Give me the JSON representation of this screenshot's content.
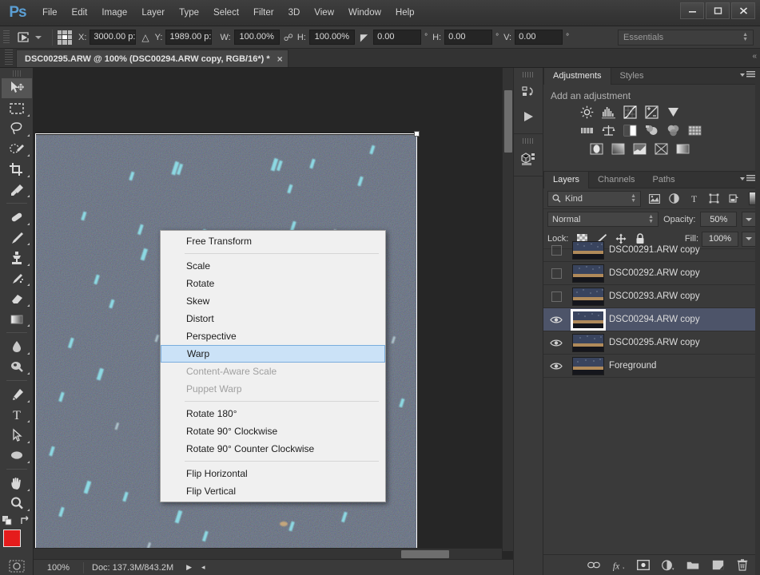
{
  "app": {
    "name": "Adobe Photoshop",
    "logo": "Ps"
  },
  "menubar": {
    "items": [
      "File",
      "Edit",
      "Image",
      "Layer",
      "Type",
      "Select",
      "Filter",
      "3D",
      "View",
      "Window",
      "Help"
    ]
  },
  "window_controls": {
    "minimize": "minimize-icon",
    "maximize": "maximize-icon",
    "close": "close-icon"
  },
  "options_bar": {
    "tool_icon": "move-tool-icon",
    "preset_caret": "chevron-down-icon",
    "reference_point_label": "reference-point-grid",
    "x_label": "X:",
    "x_value": "3000.00 p:",
    "delta_icon": "triangle-icon",
    "y_label": "Y:",
    "y_value": "1989.00 p:",
    "w_label": "W:",
    "w_value": "100.00%",
    "link_icon": "chain-link-icon",
    "h_label": "H:",
    "h_value": "100.00%",
    "angle_icon": "angle-icon",
    "angle_value": "0.00",
    "angle_unit": "°",
    "hskew_label": "H:",
    "hskew_value": "0.00",
    "hskew_unit": "°",
    "vskew_label": "V:",
    "vskew_value": "0.00",
    "vskew_unit": "°",
    "workspace": "Essentials"
  },
  "document_tab": {
    "title": "DSC00295.ARW @ 100% (DSC00294.ARW copy, RGB/16*) *",
    "close": "×"
  },
  "toolbar": {
    "tools": [
      {
        "name": "move-tool",
        "selected": true
      },
      {
        "name": "rectangular-marquee-tool",
        "selected": false
      },
      {
        "name": "lasso-tool",
        "selected": false
      },
      {
        "name": "quick-selection-tool",
        "selected": false
      },
      {
        "name": "crop-tool",
        "selected": false
      },
      {
        "name": "eyedropper-tool",
        "selected": false
      },
      {
        "name": "healing-brush-tool",
        "selected": false
      },
      {
        "name": "brush-tool",
        "selected": false
      },
      {
        "name": "clone-stamp-tool",
        "selected": false
      },
      {
        "name": "history-brush-tool",
        "selected": false
      },
      {
        "name": "eraser-tool",
        "selected": false
      },
      {
        "name": "gradient-tool",
        "selected": false
      },
      {
        "name": "blur-tool",
        "selected": false
      },
      {
        "name": "dodge-tool",
        "selected": false
      },
      {
        "name": "pen-tool",
        "selected": false
      },
      {
        "name": "type-tool",
        "selected": false
      },
      {
        "name": "path-selection-tool",
        "selected": false
      },
      {
        "name": "ellipse-shape-tool",
        "selected": false
      },
      {
        "name": "hand-tool",
        "selected": false
      },
      {
        "name": "zoom-tool",
        "selected": false
      }
    ],
    "foreground_color": "#e51c1c",
    "background_color": "#ffffff",
    "quick_mask": "quick-mask-icon"
  },
  "context_menu": {
    "items": [
      {
        "label": "Free Transform",
        "state": "normal"
      },
      {
        "separator": true
      },
      {
        "label": "Scale",
        "state": "normal"
      },
      {
        "label": "Rotate",
        "state": "normal"
      },
      {
        "label": "Skew",
        "state": "normal"
      },
      {
        "label": "Distort",
        "state": "normal"
      },
      {
        "label": "Perspective",
        "state": "normal"
      },
      {
        "label": "Warp",
        "state": "highlighted"
      },
      {
        "label": "Content-Aware Scale",
        "state": "disabled"
      },
      {
        "label": "Puppet Warp",
        "state": "disabled"
      },
      {
        "separator": true
      },
      {
        "label": "Rotate 180°",
        "state": "normal"
      },
      {
        "label": "Rotate 90° Clockwise",
        "state": "normal"
      },
      {
        "label": "Rotate 90° Counter Clockwise",
        "state": "normal"
      },
      {
        "separator": true
      },
      {
        "label": "Flip Horizontal",
        "state": "normal"
      },
      {
        "label": "Flip Vertical",
        "state": "normal"
      }
    ],
    "highlight_color": "#cbe2f7"
  },
  "status_bar": {
    "zoom": "100%",
    "doc_info": "Doc: 137.3M/843.2M",
    "play_arrow": "▶",
    "left_arrow": "◂"
  },
  "icon_dock": {
    "groups": [
      {
        "icons": [
          "history-icon",
          "actions-play-icon"
        ]
      },
      {
        "icons": [
          "3d-panel-icon"
        ]
      }
    ]
  },
  "adjustments_panel": {
    "tabs": [
      {
        "label": "Adjustments",
        "active": true
      },
      {
        "label": "Styles",
        "active": false
      }
    ],
    "title": "Add an adjustment",
    "rows": [
      [
        "brightness-contrast-icon",
        "levels-icon",
        "curves-icon",
        "exposure-icon",
        "vibrance-icon"
      ],
      [
        "hue-saturation-icon",
        "color-balance-icon",
        "black-white-icon",
        "photo-filter-icon",
        "channel-mixer-icon",
        "color-lookup-icon"
      ],
      [
        "invert-icon",
        "posterize-icon",
        "threshold-icon",
        "selective-color-icon",
        "gradient-map-icon"
      ]
    ],
    "menu_icon": "panel-menu-icon"
  },
  "layers_panel": {
    "tabs": [
      {
        "label": "Layers",
        "active": true
      },
      {
        "label": "Channels",
        "active": false
      },
      {
        "label": "Paths",
        "active": false
      }
    ],
    "menu_icon": "panel-menu-icon",
    "filter": {
      "kind_label": "Kind",
      "search_icon": "search-icon",
      "filter_icons": [
        "pixel-filter-icon",
        "adjustment-filter-icon",
        "type-filter-icon",
        "shape-filter-icon",
        "smart-object-filter-icon"
      ],
      "toggle": "filter-toggle-switch"
    },
    "blend_mode": "Normal",
    "opacity_label": "Opacity:",
    "opacity_value": "50%",
    "lock_label": "Lock:",
    "lock_icons": [
      "lock-transparency-icon",
      "lock-image-icon",
      "lock-position-icon",
      "lock-all-icon"
    ],
    "fill_label": "Fill:",
    "fill_value": "100%",
    "layers": [
      {
        "name": "DSC00291.ARW copy",
        "visible": false,
        "selected": false
      },
      {
        "name": "DSC00292.ARW copy",
        "visible": false,
        "selected": false
      },
      {
        "name": "DSC00293.ARW copy",
        "visible": false,
        "selected": false
      },
      {
        "name": "DSC00294.ARW copy",
        "visible": true,
        "selected": true
      },
      {
        "name": "DSC00295.ARW copy",
        "visible": true,
        "selected": false
      },
      {
        "name": "Foreground",
        "visible": true,
        "selected": false
      }
    ],
    "bottom_icons": [
      "link-layers-icon",
      "layer-style-fx-icon",
      "add-mask-icon",
      "new-adjustment-layer-icon",
      "new-group-icon",
      "new-layer-icon",
      "delete-layer-icon"
    ],
    "selected_row_color": "#4d5469"
  },
  "canvas": {
    "zoom_percent": "100%",
    "image_description": "night-sky-star-trails",
    "selection_border_color": "#ffffff"
  },
  "colors": {
    "chrome_bg": "#3a3a3a",
    "panel_bg": "#333333",
    "canvas_bg": "#262626",
    "accent_blue": "#5b9fd4",
    "menu_bg": "#f0f0f0"
  }
}
